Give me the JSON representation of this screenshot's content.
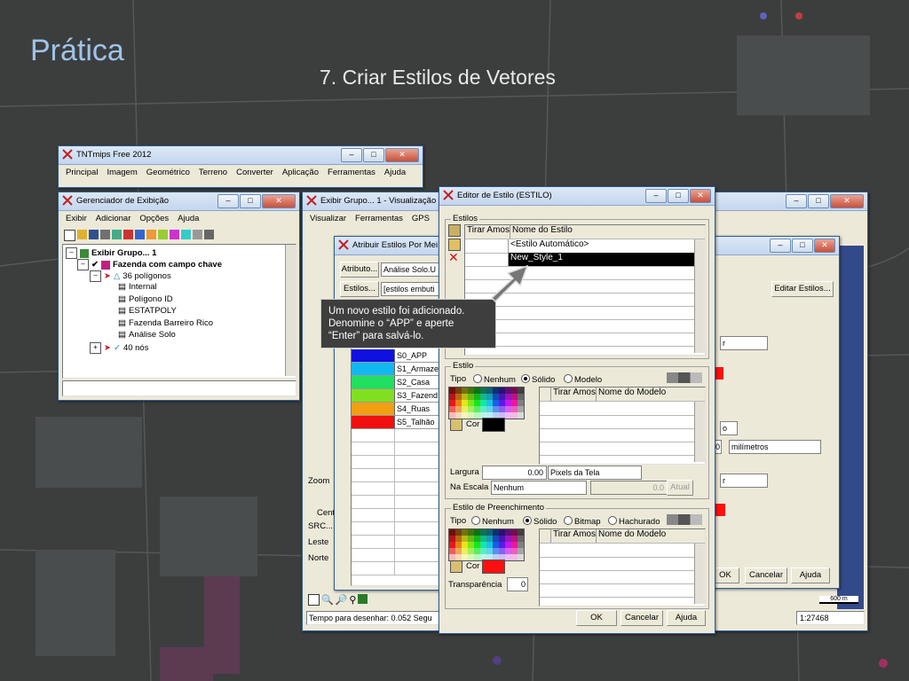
{
  "slide": {
    "title": "Prática",
    "subtitle": "7. Criar Estilos de Vetores"
  },
  "main_window": {
    "title": "TNTmips Free 2012",
    "menu": [
      "Principal",
      "Imagem",
      "Geométrico",
      "Terreno",
      "Converter",
      "Aplicação",
      "Ferramentas",
      "Ajuda"
    ]
  },
  "display_manager": {
    "title": "Gerenciador de Exibição",
    "menu": [
      "Exibir",
      "Adicionar",
      "Opções",
      "Ajuda"
    ],
    "tree": {
      "group": "Exibir Grupo... 1",
      "layer": "Fazenda com campo chave",
      "polygons": "36 polígonos",
      "tables": [
        "Internal",
        "Polígono ID",
        "ESTATPOLY",
        "Fazenda Barreiro Rico",
        "Análise Solo"
      ],
      "nodes": "40 nós"
    }
  },
  "view_window": {
    "title": "Exibir Grupo... 1 - Visualização 1",
    "menu": [
      "Visualizar",
      "Ferramentas",
      "GPS"
    ],
    "zoom_label": "Zoom",
    "center_label": "Cent",
    "src_label": "SRC...",
    "east_label": "Leste",
    "north_label": "Norte",
    "status": "Tempo para desenhar: 0.052 Segu",
    "scale": "1:27468",
    "scale_bar": "600 m"
  },
  "assign_styles": {
    "title": "Atribuir Estilos Por Mei",
    "attribute_button": "Atributo...",
    "attribute_value": "Análise Solo.U",
    "styles_button": "Estilos...",
    "styles_value": "[estilos embuti",
    "rows": [
      {
        "color": "#1010e0",
        "label": "S0_APP"
      },
      {
        "color": "#10b8f0",
        "label": "S1_Armaze"
      },
      {
        "color": "#20e060",
        "label": "S2_Casa"
      },
      {
        "color": "#80e020",
        "label": "S3_Fazend"
      },
      {
        "color": "#f0a010",
        "label": "S4_Ruas"
      },
      {
        "color": "#f01010",
        "label": "S5_Talhão"
      }
    ]
  },
  "back_dialog": {
    "edit_styles_button": "Editar Estilos...",
    "units_value": "milímetros",
    "ok": "OK",
    "cancel": "Cancelar",
    "help": "Ajuda"
  },
  "style_editor": {
    "title": "Editor de Estilo (ESTILO)",
    "styles_group": "Estilos",
    "col_sample": "Tirar Amos",
    "col_name": "Nome do Estilo",
    "styles": [
      "<Estilo Automático>",
      "New_Style_1"
    ],
    "line_group": "Estilo",
    "type_label": "Tipo",
    "line_types": [
      "Nenhum",
      "Sólido",
      "Modelo"
    ],
    "pattern_sample": "Tirar Amos",
    "pattern_name": "Nome do Modelo",
    "color_label": "Cor",
    "line_color": "#000000",
    "width_label": "Largura",
    "width_value": "0.00",
    "width_unit": "Pixels da Tela",
    "scale_label": "Na Escala",
    "scale_value": "Nenhum",
    "scale_num": "0.0",
    "update_button": "Atual",
    "fill_group": "Estilo de Preenchimento",
    "fill_types": [
      "Nenhum",
      "Sólido",
      "Bitmap",
      "Hachurado"
    ],
    "fill_color": "#ff1010",
    "transparency_label": "Transparência",
    "transparency_value": "0",
    "ok": "OK",
    "cancel": "Cancelar",
    "help": "Ajuda"
  },
  "callout": {
    "lines": [
      "Um novo estilo foi adicionado.",
      "Denomine o “APP” e aperte",
      "“Enter” para salvá-lo."
    ]
  }
}
